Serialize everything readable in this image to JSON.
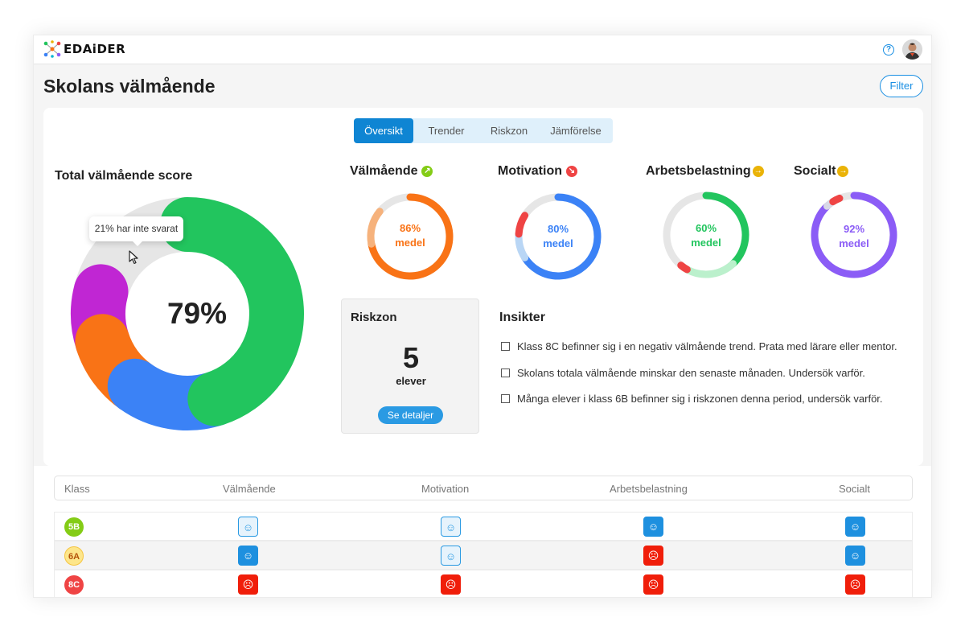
{
  "app": {
    "logo": "EDAiDER",
    "help_icon": "?"
  },
  "page": {
    "title": "Skolans välmående",
    "filter_label": "Filter"
  },
  "tabs": [
    {
      "label": "Översikt",
      "active": true
    },
    {
      "label": "Trender",
      "active": false
    },
    {
      "label": "Riskzon",
      "active": false
    },
    {
      "label": "Jämförelse",
      "active": false
    }
  ],
  "total": {
    "title": "Total välmående score",
    "value": "79%",
    "tooltip": "21% har inte svarat",
    "segments": [
      {
        "name": "green",
        "color": "#22c55e",
        "share": 0.45
      },
      {
        "name": "blue",
        "color": "#3b82f6",
        "share": 0.15
      },
      {
        "name": "orange",
        "color": "#f97316",
        "share": 0.1
      },
      {
        "name": "purple",
        "color": "#c026d3",
        "share": 0.09
      },
      {
        "name": "grey",
        "color": "#e6e6e6",
        "share": 0.21
      }
    ]
  },
  "metrics": [
    {
      "title": "Välmående",
      "trend": "up",
      "trend_icon": "↗",
      "trend_color": "#84cc16",
      "value": "86%",
      "unit": "medel",
      "color": "#f97316",
      "segments": [
        {
          "color": "#f97316",
          "share": 0.72
        },
        {
          "color": "#f6b27c",
          "share": 0.14
        },
        {
          "color": "#e6e6e6",
          "share": 0.14
        }
      ]
    },
    {
      "title": "Motivation",
      "trend": "down",
      "trend_icon": "↘",
      "trend_color": "#ef4444",
      "value": "80%",
      "unit": "medel",
      "color": "#3b82f6",
      "segments": [
        {
          "color": "#3b82f6",
          "share": 0.66
        },
        {
          "color": "#b9d6f5",
          "share": 0.1
        },
        {
          "color": "#ef4444",
          "share": 0.08
        },
        {
          "color": "#e6e6e6",
          "share": 0.16
        }
      ]
    },
    {
      "title": "Arbetsbelastning",
      "trend": "flat",
      "trend_icon": "→",
      "trend_color": "#eab308",
      "value": "60%",
      "unit": "medel",
      "color": "#22c55e",
      "segments": [
        {
          "color": "#22c55e",
          "share": 0.38
        },
        {
          "color": "#bbf0cc",
          "share": 0.2
        },
        {
          "color": "#ef4444",
          "share": 0.03
        },
        {
          "color": "#e6e6e6",
          "share": 0.39
        }
      ]
    },
    {
      "title": "Socialt",
      "trend": "flat",
      "trend_icon": "→",
      "trend_color": "#eab308",
      "value": "92%",
      "unit": "medel",
      "color": "#8b5cf6",
      "segments": [
        {
          "color": "#8b5cf6",
          "share": 0.88
        },
        {
          "color": "#d8d8e6",
          "share": 0.03
        },
        {
          "color": "#ef4444",
          "share": 0.03
        },
        {
          "color": "#e6e6e6",
          "share": 0.06
        }
      ]
    }
  ],
  "risk": {
    "title": "Riskzon",
    "count": "5",
    "unit": "elever",
    "button": "Se detaljer"
  },
  "insights": {
    "title": "Insikter",
    "items": [
      "Klass 8C befinner sig i en negativ välmående trend. Prata med lärare eller mentor.",
      "Skolans totala välmående minskar den senaste månaden. Undersök varför.",
      "Många elever i klass 6B befinner sig i riskzonen denna period, undersök varför."
    ]
  },
  "table": {
    "headers": [
      "Klass",
      "Välmående",
      "Motivation",
      "Arbetsbelastning",
      "Socialt"
    ],
    "rows": [
      {
        "class": "5B",
        "class_color": "#84cc16",
        "cells": [
          "neutral-outline",
          "neutral-outline",
          "happy",
          "happy"
        ]
      },
      {
        "class": "6A",
        "class_color": "#fde68a",
        "cells": [
          "happy",
          "neutral-outline",
          "sad",
          "happy"
        ]
      },
      {
        "class": "8C",
        "class_color": "#ef4444",
        "cells": [
          "sad",
          "sad",
          "sad",
          "sad"
        ]
      }
    ]
  }
}
